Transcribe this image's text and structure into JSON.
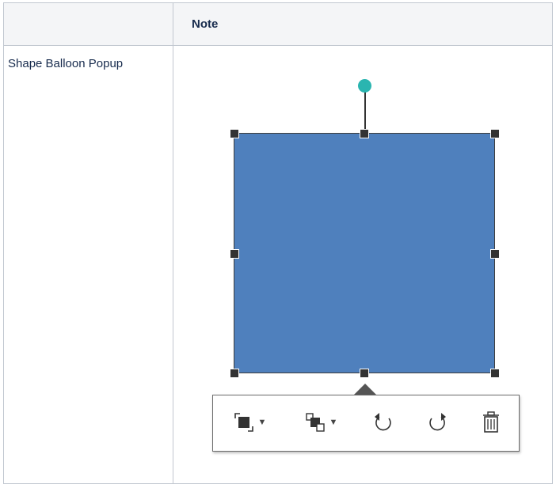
{
  "table": {
    "header": {
      "col1": "",
      "col2": "Note"
    },
    "row": {
      "label": "Shape Balloon Popup"
    }
  },
  "balloon_popup": {
    "buttons": [
      {
        "name": "arrange-order",
        "icon": "bring-to-front-icon",
        "has_dropdown": true,
        "caret": "▼"
      },
      {
        "name": "group",
        "icon": "group-shapes-icon",
        "has_dropdown": true,
        "caret": "▼"
      },
      {
        "name": "rotate-left",
        "icon": "rotate-left-icon",
        "has_dropdown": false
      },
      {
        "name": "rotate-right",
        "icon": "rotate-right-icon",
        "has_dropdown": false
      },
      {
        "name": "delete",
        "icon": "trash-icon",
        "has_dropdown": false
      }
    ]
  },
  "colors": {
    "shape_fill": "#4f80bd",
    "rotation_handle": "#2ab5b0",
    "handle": "#333333",
    "table_border": "#c1c7d0",
    "header_bg": "#f4f5f7"
  }
}
